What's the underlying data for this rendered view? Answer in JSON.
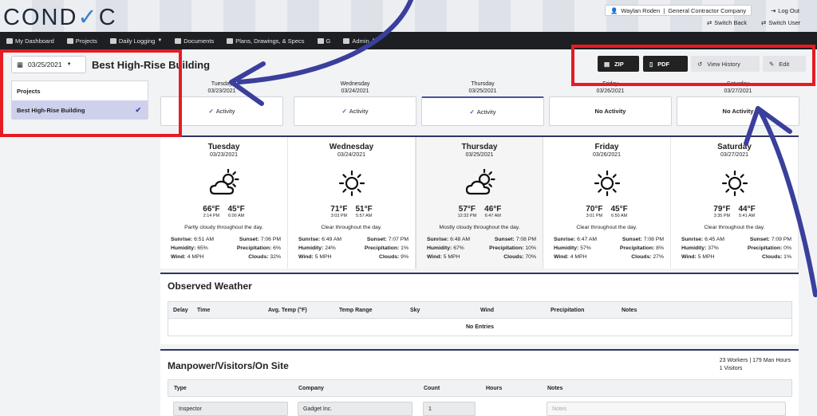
{
  "header": {
    "logo_left": "COND",
    "logo_check": "✓",
    "logo_right": "C",
    "user": "Waylan Roden",
    "company": "General Contractor Company",
    "logout": "Log Out",
    "switch_back": "Switch Back",
    "switch_user": "Switch User"
  },
  "nav": {
    "dashboard": "My Dashboard",
    "projects": "Projects",
    "daily_logging": "Daily Logging",
    "documents": "Documents",
    "plans": "Plans, Drawings, & Specs",
    "g": "G",
    "admin": "Admin"
  },
  "sidebar": {
    "date": "03/25/2021",
    "items": [
      {
        "label": "Projects"
      },
      {
        "label": "Best High-Rise Building"
      }
    ]
  },
  "page_title": "Best High-Rise Building",
  "toolbar": {
    "zip": "ZIP",
    "pdf": "PDF",
    "history": "View History",
    "edit": "Edit"
  },
  "days": [
    {
      "name": "Tuesday",
      "date": "03/23/2021",
      "status": "Activity"
    },
    {
      "name": "Wednesday",
      "date": "03/24/2021",
      "status": "Activity"
    },
    {
      "name": "Thursday",
      "date": "03/25/2021",
      "status": "Activity"
    },
    {
      "name": "Friday",
      "date": "03/26/2021",
      "status": "No Activity"
    },
    {
      "name": "Saturday",
      "date": "03/27/2021",
      "status": "No Activity"
    }
  ],
  "weather": [
    {
      "name": "Tuesday",
      "date": "03/23/2021",
      "icon": "partly-cloudy-icon",
      "high": "66°F",
      "high_time": "2:14 PM",
      "low": "45°F",
      "low_time": "6:00 AM",
      "desc": "Partly cloudy throughout the day.",
      "sunrise": "6:51 AM",
      "sunset": "7:06 PM",
      "humidity": "65%",
      "precip": "6%",
      "wind": "4 MPH",
      "clouds": "32%"
    },
    {
      "name": "Wednesday",
      "date": "03/24/2021",
      "icon": "sun-icon",
      "high": "71°F",
      "high_time": "3:03 PM",
      "low": "51°F",
      "low_time": "5:57 AM",
      "desc": "Clear throughout the day.",
      "sunrise": "6:49 AM",
      "sunset": "7:07 PM",
      "humidity": "24%",
      "precip": "1%",
      "wind": "5 MPH",
      "clouds": "9%"
    },
    {
      "name": "Thursday",
      "date": "03/25/2021",
      "icon": "partly-cloudy-icon",
      "high": "57°F",
      "high_time": "12:32 PM",
      "low": "46°F",
      "low_time": "6:47 AM",
      "desc": "Mostly cloudy throughout the day.",
      "sunrise": "6:48 AM",
      "sunset": "7:08 PM",
      "humidity": "67%",
      "precip": "10%",
      "wind": "5 MPH",
      "clouds": "70%"
    },
    {
      "name": "Friday",
      "date": "03/26/2021",
      "icon": "sun-icon",
      "high": "70°F",
      "high_time": "3:01 PM",
      "low": "45°F",
      "low_time": "6:50 AM",
      "desc": "Clear throughout the day.",
      "sunrise": "6:47 AM",
      "sunset": "7:08 PM",
      "humidity": "57%",
      "precip": "8%",
      "wind": "4 MPH",
      "clouds": "27%"
    },
    {
      "name": "Saturday",
      "date": "03/27/2021",
      "icon": "sun-icon",
      "high": "79°F",
      "high_time": "3:35 PM",
      "low": "44°F",
      "low_time": "5:41 AM",
      "desc": "Clear throughout the day.",
      "sunrise": "6:45 AM",
      "sunset": "7:09 PM",
      "humidity": "37%",
      "precip": "0%",
      "wind": "5 MPH",
      "clouds": "1%"
    }
  ],
  "labels": {
    "sunrise": "Sunrise:",
    "sunset": "Sunset:",
    "humidity": "Humidity:",
    "precip": "Precipitation:",
    "wind": "Wind:",
    "clouds": "Clouds:"
  },
  "observed": {
    "title": "Observed Weather",
    "columns": [
      "Delay",
      "Time",
      "Avg. Temp (°F)",
      "Temp Range",
      "Sky",
      "Wind",
      "Precipitation",
      "Notes"
    ],
    "empty": "No Entries"
  },
  "manpower": {
    "title": "Manpower/Visitors/On Site",
    "summary_workers": "23 Workers | 179 Man Hours",
    "summary_visitors": "1 Visitors",
    "columns": [
      "Type",
      "Company",
      "Count",
      "Hours",
      "Notes"
    ],
    "row": {
      "type": "Inspector",
      "company": "Gadget Inc.",
      "count": "1",
      "notes_placeholder": "Notes"
    }
  },
  "colors": {
    "annotation_red": "#e51c23",
    "annotation_blue": "#3a3f9c",
    "nav_bg": "#1d1f22",
    "accent": "#2f3563"
  }
}
